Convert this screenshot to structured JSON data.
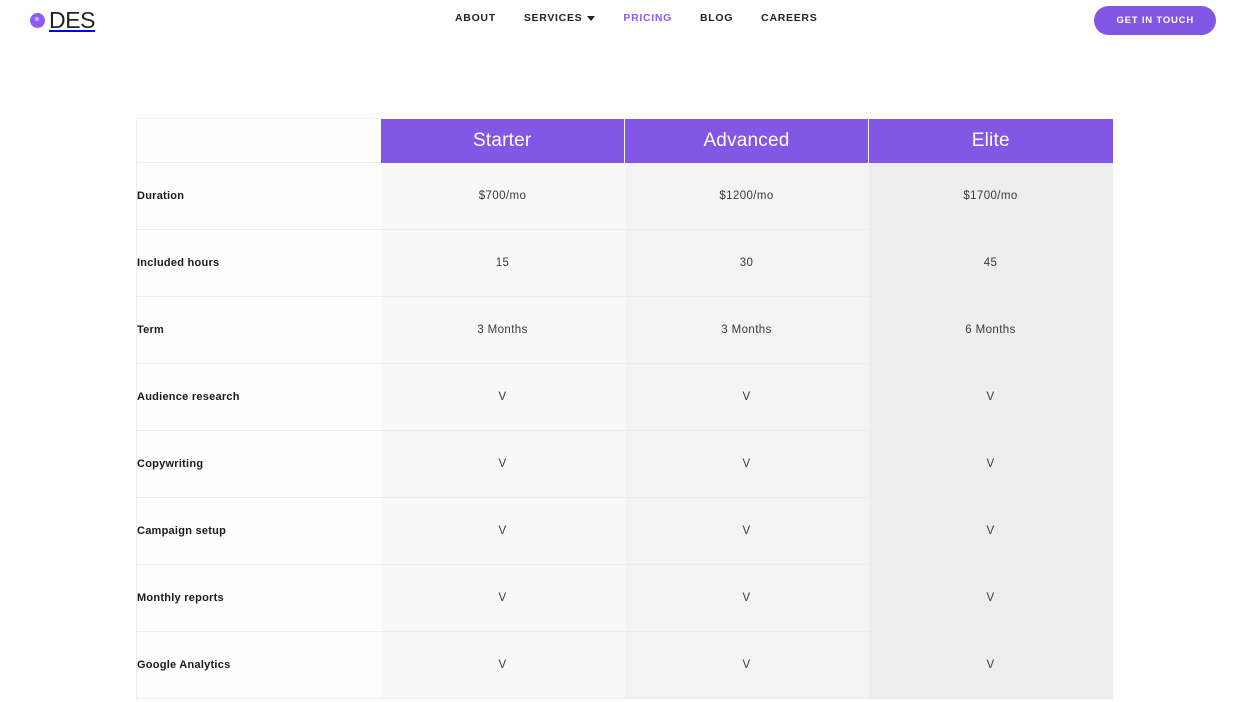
{
  "header": {
    "brand": {
      "name": "DES",
      "dot_color": "#8b5cf6"
    },
    "nav": [
      {
        "label": "ABOUT",
        "active": false,
        "has_caret": false
      },
      {
        "label": "SERVICES",
        "active": false,
        "has_caret": true
      },
      {
        "label": "PRICING",
        "active": true,
        "has_caret": false
      },
      {
        "label": "BLOG",
        "active": false,
        "has_caret": false
      },
      {
        "label": "CAREERS",
        "active": false,
        "has_caret": false
      }
    ],
    "cta_label": "GET IN TOUCH",
    "accent_color": "#8257e6"
  },
  "pricing_table": {
    "corner_label": "",
    "plans": [
      "Starter",
      "Advanced",
      "Elite"
    ],
    "rows": [
      {
        "label": "Duration",
        "values": [
          "$700/mo",
          "$1200/mo",
          "$1700/mo"
        ]
      },
      {
        "label": "Included hours",
        "values": [
          "15",
          "30",
          "45"
        ]
      },
      {
        "label": "Term",
        "values": [
          "3 Months",
          "3 Months",
          "6 Months"
        ]
      },
      {
        "label": "Audience research",
        "values": [
          "V",
          "V",
          "V"
        ]
      },
      {
        "label": "Copywriting",
        "values": [
          "V",
          "V",
          "V"
        ]
      },
      {
        "label": "Campaign setup",
        "values": [
          "V",
          "V",
          "V"
        ]
      },
      {
        "label": "Monthly reports",
        "values": [
          "V",
          "V",
          "V"
        ]
      },
      {
        "label": "Google Analytics",
        "values": [
          "V",
          "V",
          "V"
        ]
      }
    ]
  }
}
